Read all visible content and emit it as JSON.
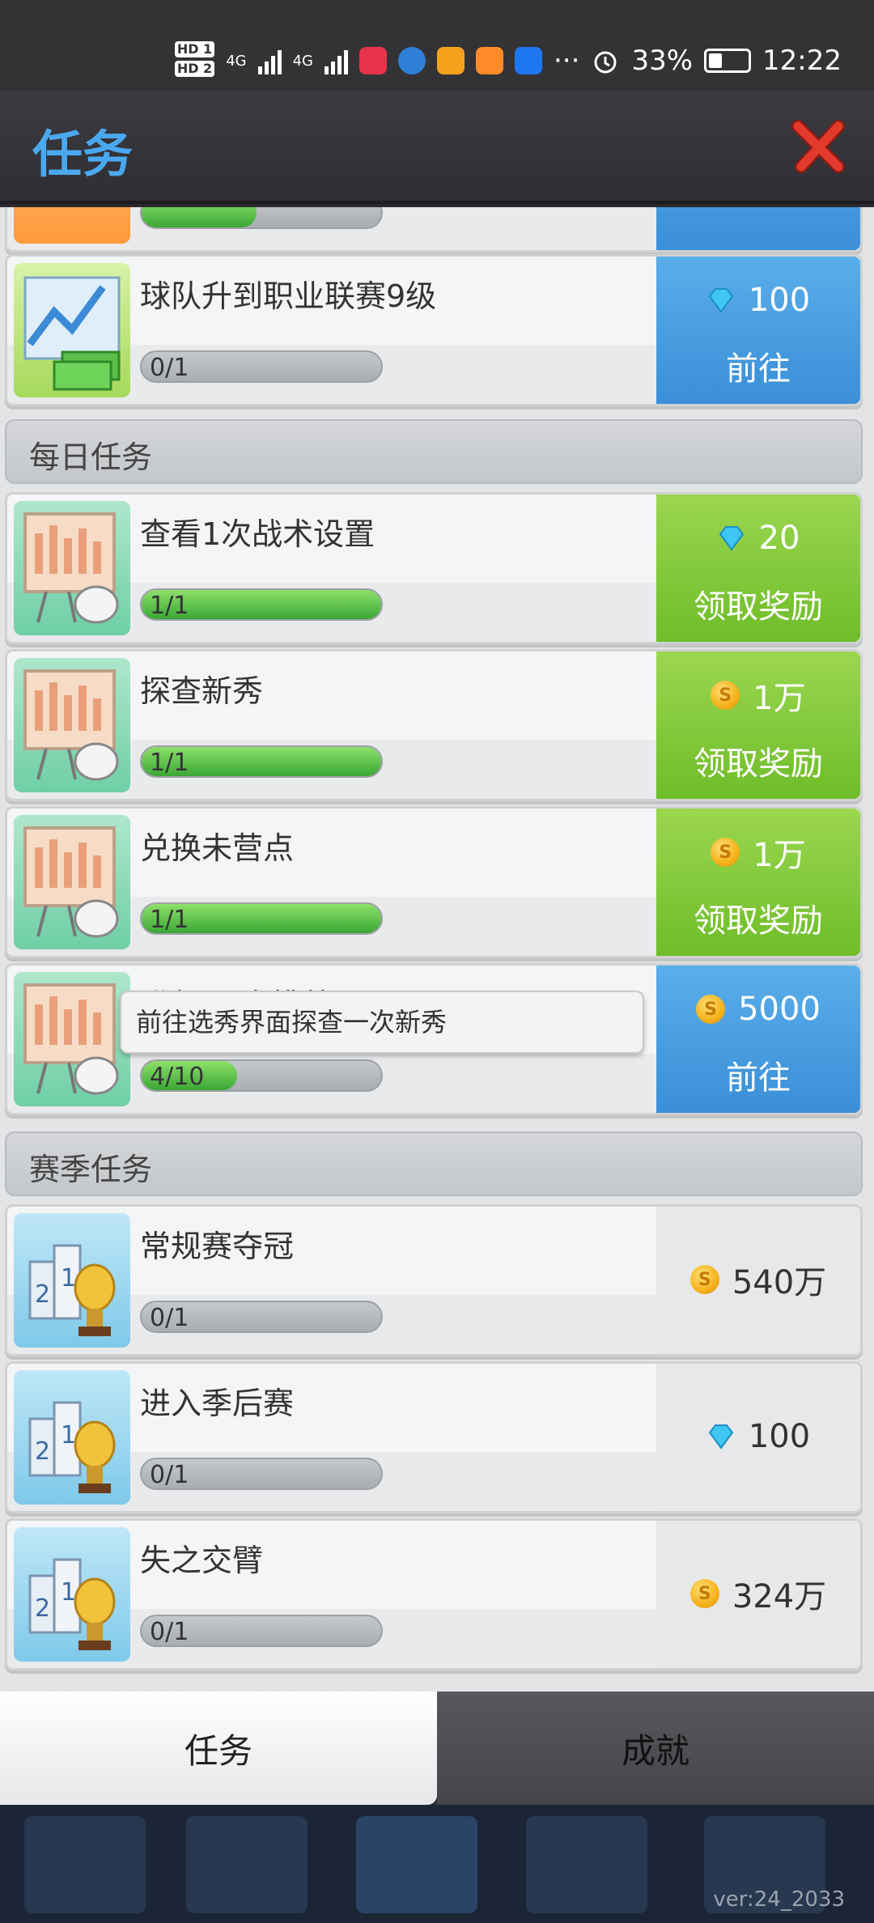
{
  "status_bar": {
    "hd1": "HD 1",
    "hd2": "HD 2",
    "net1": "4G",
    "net2": "4G",
    "more": "···",
    "battery": "33%",
    "time": "12:22"
  },
  "header": {
    "title": "任务",
    "close_icon": "close-icon",
    "accent": "#4aa8ef"
  },
  "tasks_top": [
    {
      "title": "球队升到职业联赛9级",
      "progress_text": "0/1",
      "progress": 0.0,
      "reward_type": "gem",
      "reward_value": "100",
      "action": "前往",
      "action_color": "blue"
    }
  ],
  "sections": {
    "daily": "每日任务",
    "season": "赛季任务"
  },
  "daily_tasks": [
    {
      "title": "查看1次战术设置",
      "progress_text": "1/1",
      "progress": 1.0,
      "reward_type": "gem",
      "reward_value": "20",
      "action": "领取奖励",
      "action_color": "green"
    },
    {
      "title": "探查新秀",
      "progress_text": "1/1",
      "progress": 1.0,
      "reward_type": "coin",
      "reward_value": "1万",
      "action": "领取奖励",
      "action_color": "green"
    },
    {
      "title": "兑换未营点",
      "progress_text": "1/1",
      "progress": 1.0,
      "reward_type": "coin",
      "reward_value": "1万",
      "action": "领取奖励",
      "action_color": "green"
    },
    {
      "title": "进行10次挑战",
      "progress_text": "4/10",
      "progress": 0.4,
      "reward_type": "coin",
      "reward_value": "5000",
      "action": "前往",
      "action_color": "blue"
    }
  ],
  "season_tasks": [
    {
      "title": "常规赛夺冠",
      "progress_text": "0/1",
      "progress": 0.0,
      "reward_type": "coin",
      "reward_value": "540万"
    },
    {
      "title": "进入季后赛",
      "progress_text": "0/1",
      "progress": 0.0,
      "reward_type": "gem",
      "reward_value": "100"
    },
    {
      "title": "失之交臂",
      "progress_text": "0/1",
      "progress": 0.0,
      "reward_type": "coin",
      "reward_value": "324万"
    }
  ],
  "tooltip": "前往选秀界面探查一次新秀",
  "tabs": {
    "tasks": "任务",
    "achievements": "成就"
  },
  "version": "ver:24_2033"
}
